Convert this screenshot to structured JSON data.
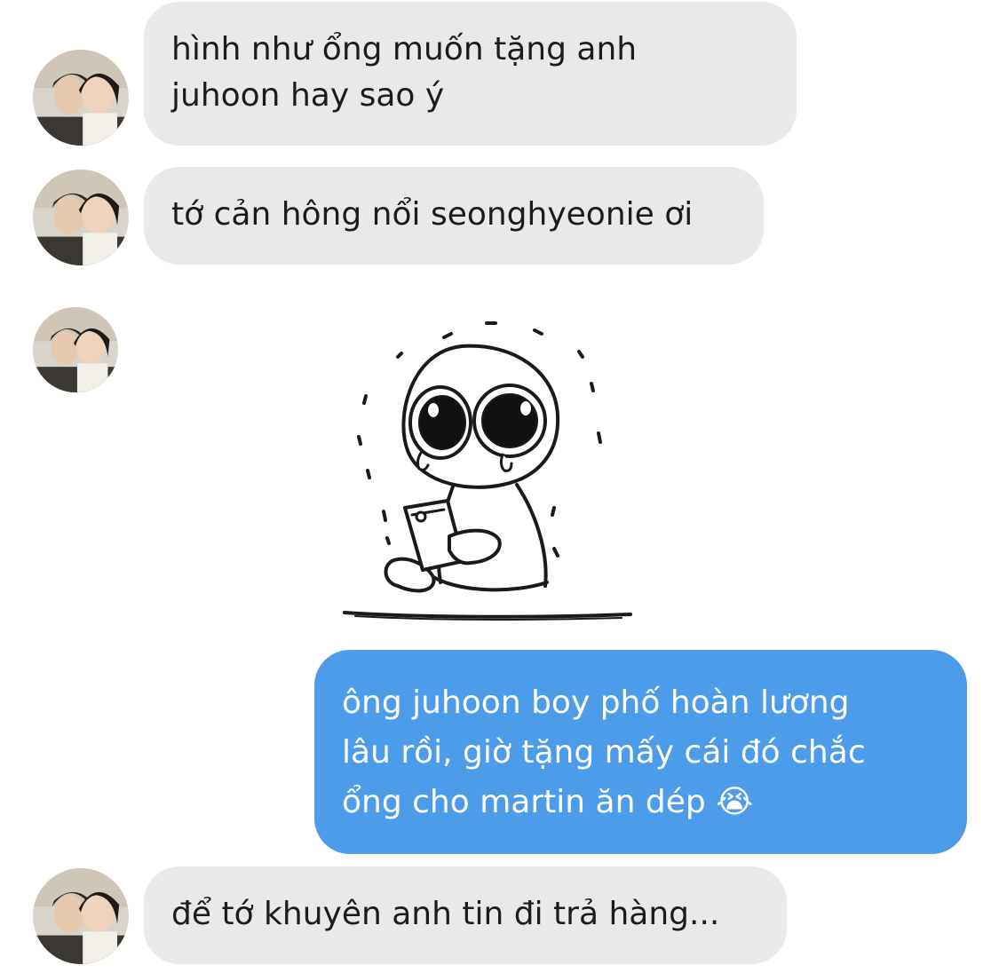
{
  "conversation": {
    "messages": [
      {
        "sender": "them",
        "text": "hình như ổng muốn tặng anh\njuhoon hay sao ý"
      },
      {
        "sender": "them",
        "text": "tớ cản hông nổi seonghyeonie ơi"
      },
      {
        "sender": "them",
        "type": "sticker",
        "sticker_icon": "crying-character-holding-phone-icon"
      },
      {
        "sender": "me",
        "text": "ông juhoon boy phố hoàn lương\nlâu rồi, giờ tặng mấy cái đó chắc\nổng cho martin ăn dép 😭"
      },
      {
        "sender": "them",
        "text": "để tớ khuyên anh tin đi trả hàng..."
      }
    ]
  },
  "colors": {
    "incoming_bubble": "#e9e9eb",
    "outgoing_bubble": "#4d9cea",
    "incoming_text": "#1c1c1e",
    "outgoing_text": "#ffffff",
    "background": "#ffffff"
  },
  "avatar_icon": "contact-photo-avatar"
}
